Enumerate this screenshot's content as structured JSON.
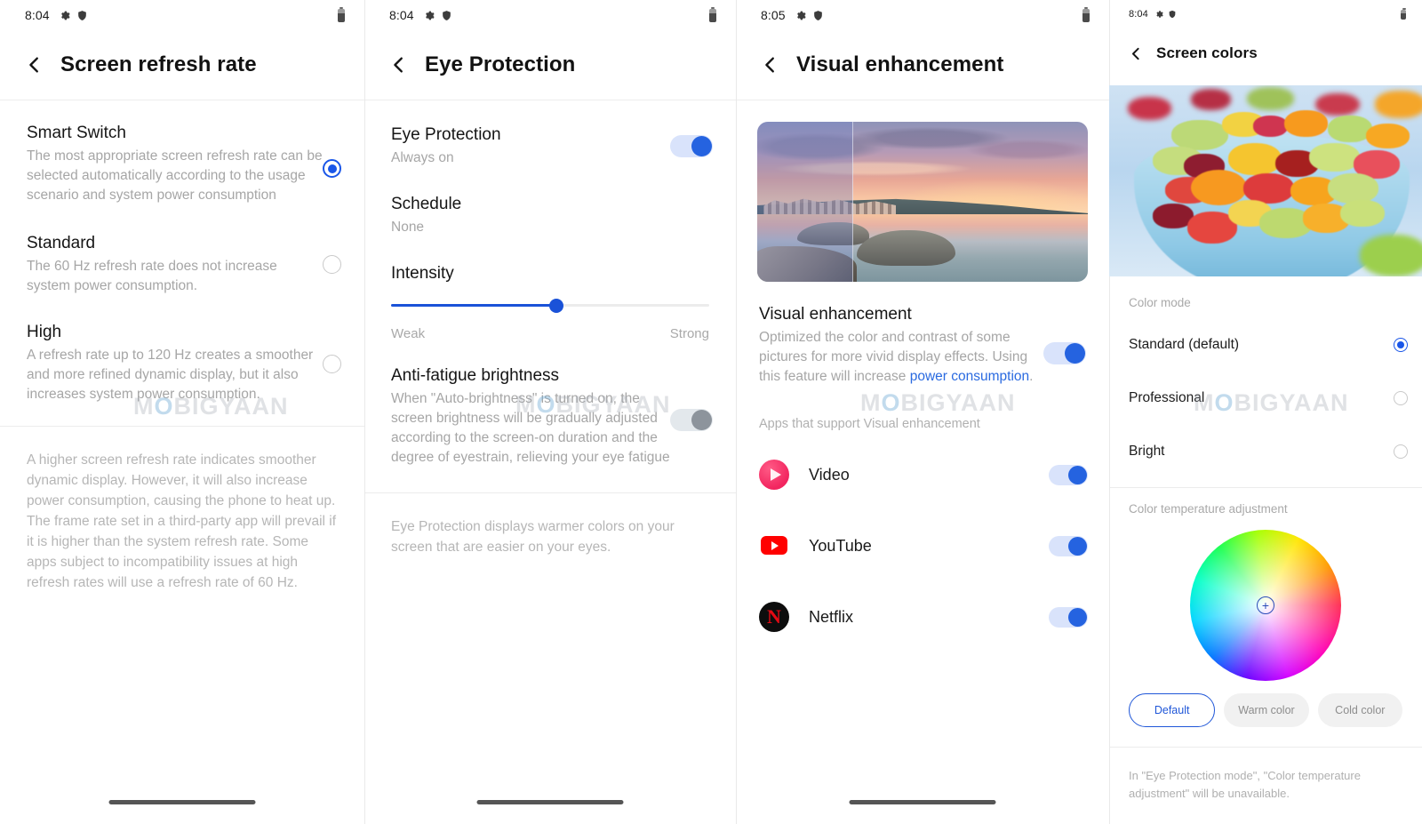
{
  "watermark": {
    "pre": "M",
    "o": "O",
    "post": "BIGYAAN"
  },
  "panels": [
    {
      "id": "screen-refresh-rate",
      "status": {
        "time": "8:04",
        "icons": [
          "gear-icon",
          "shield-icon",
          "battery-icon"
        ]
      },
      "title": "Screen refresh rate",
      "options": [
        {
          "label": "Smart Switch",
          "desc": "The most appropriate screen refresh rate can be selected automatically according to the usage scenario and system power consumption",
          "selected": true
        },
        {
          "label": "Standard",
          "desc": "The 60 Hz refresh rate does not increase system power consumption.",
          "selected": false
        },
        {
          "label": "High",
          "desc": "A refresh rate up to 120 Hz creates a smoother and more refined dynamic display, but it also increases system power consumption.",
          "selected": false
        }
      ],
      "note": "A higher screen refresh rate indicates smoother dynamic display. However, it will also increase power consumption, causing the phone to heat up. The frame rate set in a third-party app will prevail if it is higher than the system refresh rate. Some apps subject to incompatibility issues at high refresh rates will use a refresh rate of 60 Hz."
    },
    {
      "id": "eye-protection",
      "status": {
        "time": "8:04"
      },
      "title": "Eye Protection",
      "rows": [
        {
          "label": "Eye Protection",
          "value": "Always on",
          "toggle": "on"
        },
        {
          "label": "Schedule",
          "value": "None"
        }
      ],
      "intensity": {
        "label": "Intensity",
        "percent": 50,
        "min_label": "Weak",
        "max_label": "Strong"
      },
      "anti_fatigue": {
        "label": "Anti-fatigue brightness",
        "desc": "When \"Auto-brightness\" is turned on, the screen brightness will be gradually adjusted according to the screen-on duration and the degree of eyestrain, relieving your eye fatigue",
        "toggle": "off"
      },
      "note": "Eye Protection displays warmer colors on your screen that are easier on your eyes."
    },
    {
      "id": "visual-enhancement",
      "status": {
        "time": "8:05"
      },
      "title": "Visual enhancement",
      "hero_alt": "coastal-sunset-preview",
      "main": {
        "label": "Visual enhancement",
        "desc_part1": "Optimized the color and contrast of some pictures for more vivid display effects. Using this feature will increase ",
        "desc_link": "power consumption",
        "desc_part2": ".",
        "toggle": "on"
      },
      "apps_section_label": "Apps that support Visual enhancement",
      "apps": [
        {
          "name": "Video",
          "icon": "video-player-icon",
          "toggle": "on"
        },
        {
          "name": "YouTube",
          "icon": "youtube-icon",
          "toggle": "on"
        },
        {
          "name": "Netflix",
          "icon": "netflix-icon",
          "toggle": "on"
        }
      ]
    },
    {
      "id": "screen-colors",
      "status": {
        "time": "8:04"
      },
      "title": "Screen colors",
      "preview_alt": "fruit-bowl-preview",
      "color_mode_label": "Color mode",
      "color_modes": [
        {
          "label": "Standard (default)",
          "selected": true
        },
        {
          "label": "Professional",
          "selected": false
        },
        {
          "label": "Bright",
          "selected": false
        }
      ],
      "temperature_label": "Color temperature adjustment",
      "wheel_marker": "+",
      "temperature_chips": [
        {
          "label": "Default",
          "selected": true
        },
        {
          "label": "Warm color",
          "selected": false
        },
        {
          "label": "Cold color",
          "selected": false
        }
      ],
      "note": "In \"Eye Protection mode\", \"Color temperature adjustment\" will be unavailable."
    }
  ],
  "colors": {
    "accent_blue": "#1a56e8",
    "toggle_on": "#2563e0",
    "toggle_track_on": "#d9e3fb",
    "toggle_off": "#8d949c",
    "link_blue": "#2a6ae0",
    "text_primary": "#151515",
    "text_secondary": "#a6a6a6"
  }
}
